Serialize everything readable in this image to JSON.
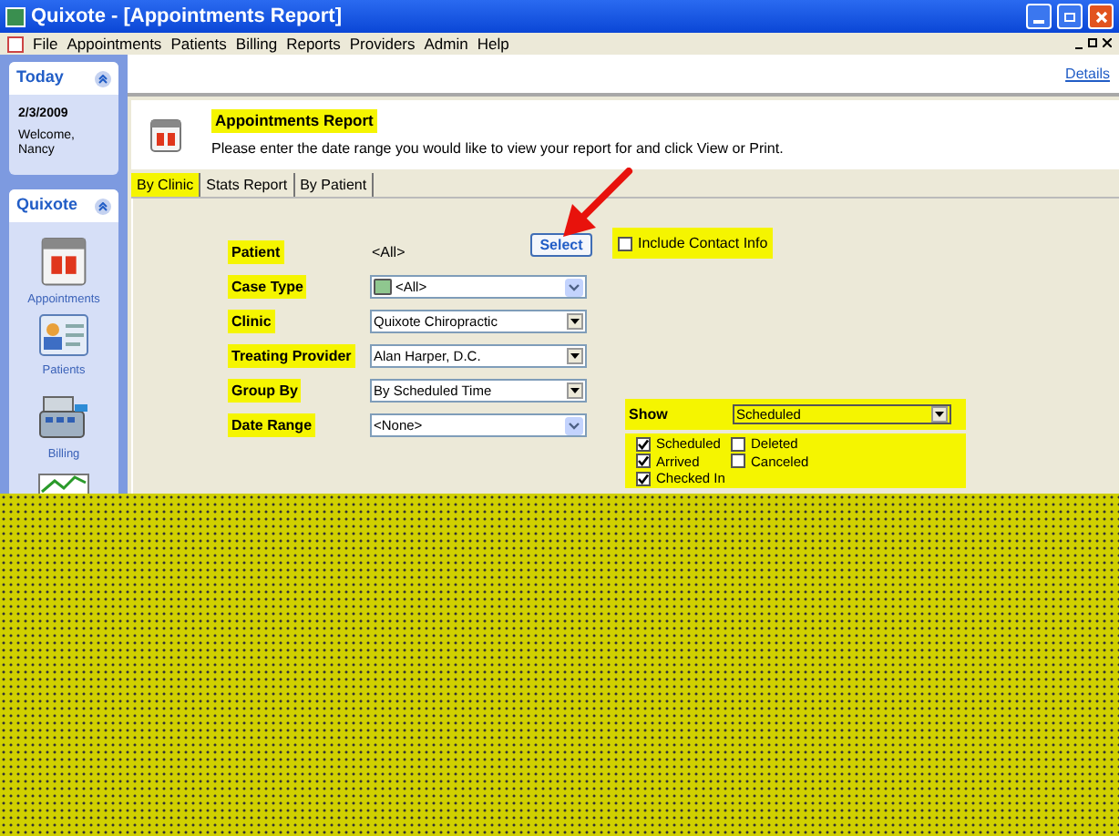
{
  "window": {
    "title": "Quixote - [Appointments Report]"
  },
  "menu": [
    "File",
    "Appointments",
    "Patients",
    "Billing",
    "Reports",
    "Providers",
    "Admin",
    "Help"
  ],
  "today_panel": {
    "title": "Today",
    "date": "2/3/2009",
    "greeting": "Welcome, Nancy"
  },
  "nav_panel": {
    "title": "Quixote",
    "items": [
      {
        "kind": "calendar",
        "label": "Appointments"
      },
      {
        "kind": "card",
        "label": "Patients"
      },
      {
        "kind": "register",
        "label": "Billing"
      },
      {
        "kind": "chart"
      }
    ]
  },
  "details_link": "Details",
  "report": {
    "title": "Appointments Report",
    "instructions": "Please enter the date range you would like to view your report for and click View or Print."
  },
  "tabs": [
    {
      "label": "By Clinic",
      "selected": true
    },
    {
      "label": "Stats Report",
      "selected": false
    },
    {
      "label": "By Patient",
      "selected": false
    }
  ],
  "fields": [
    {
      "kind": "text",
      "label": "Patient",
      "value": "<All>"
    },
    {
      "kind": "combo",
      "label": "Case Type",
      "value": "<All>"
    },
    {
      "kind": "dropdown",
      "label": "Clinic",
      "value": "Quixote Chiropractic"
    },
    {
      "kind": "dropdown",
      "label": "Treating Provider",
      "value": "Alan Harper, D.C."
    },
    {
      "kind": "dropdown",
      "label": "Group By",
      "value": "By Scheduled Time"
    },
    {
      "kind": "combo",
      "label": "Date Range",
      "value": "<None>"
    }
  ],
  "select_button": "Select",
  "include_contact_info": {
    "label": "Include Contact Info",
    "checked": false
  },
  "show": {
    "label": "Show",
    "value": "Scheduled",
    "options": [
      {
        "label": "Scheduled",
        "checked": true
      },
      {
        "label": "Deleted",
        "checked": false
      },
      {
        "label": "Arrived",
        "checked": true
      },
      {
        "label": "Canceled",
        "checked": false
      },
      {
        "label": "Checked In",
        "checked": true
      }
    ]
  }
}
